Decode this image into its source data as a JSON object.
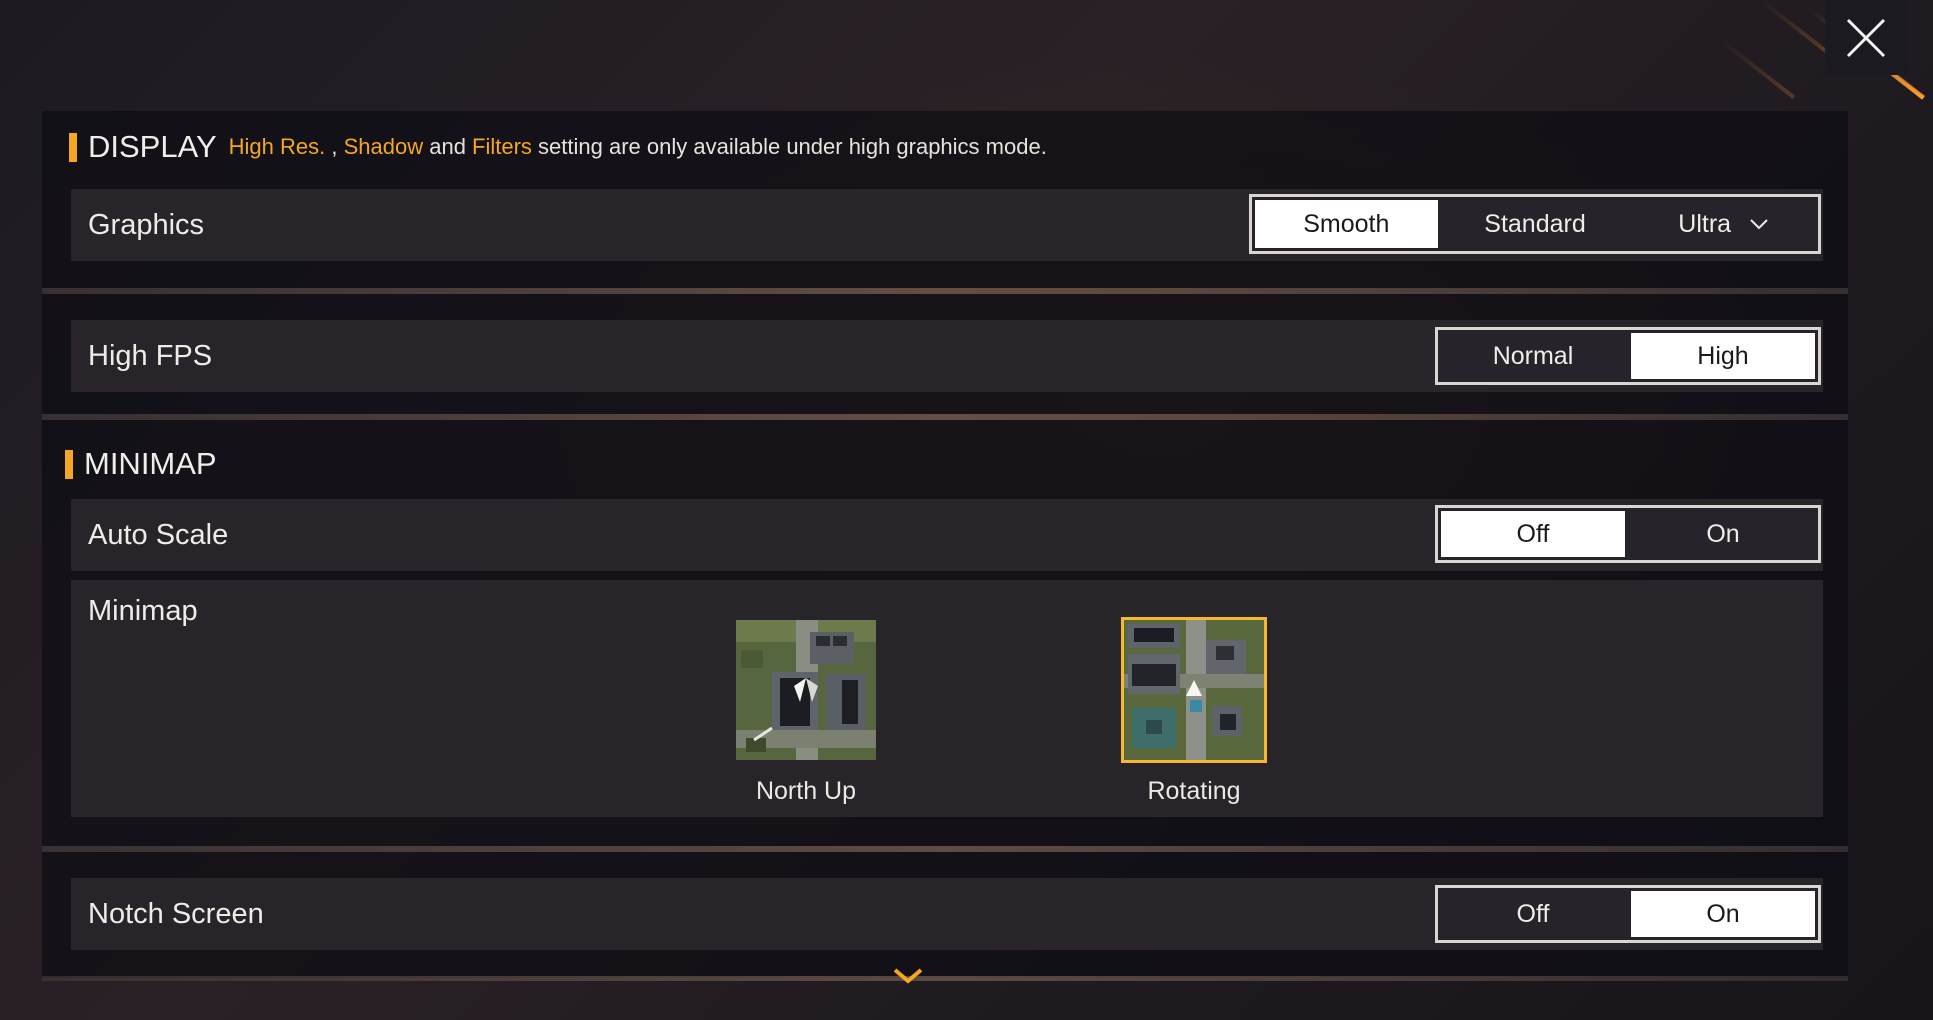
{
  "close_button": {
    "icon": "close-icon"
  },
  "display": {
    "title": "DISPLAY",
    "hint_parts": {
      "hl1": "High Res.",
      "sep": " , ",
      "hl2": "Shadow",
      "and": " and ",
      "hl3": "Filters",
      "tail": " setting are only available under high graphics mode."
    },
    "graphics": {
      "label": "Graphics",
      "options": [
        "Smooth",
        "Standard",
        "Ultra"
      ],
      "selected": "Smooth"
    },
    "high_fps": {
      "label": "High FPS",
      "options": [
        "Normal",
        "High"
      ],
      "selected": "High"
    }
  },
  "minimap_section": {
    "title": "MINIMAP",
    "auto_scale": {
      "label": "Auto Scale",
      "options": [
        "Off",
        "On"
      ],
      "selected": "Off"
    },
    "minimap": {
      "label": "Minimap",
      "options": [
        "North Up",
        "Rotating"
      ],
      "selected": "Rotating"
    }
  },
  "notch_screen": {
    "label": "Notch Screen",
    "options": [
      "Off",
      "On"
    ],
    "selected": "On"
  },
  "colors": {
    "accent": "#f5a623",
    "selected_option_bg": "#ffffff"
  }
}
